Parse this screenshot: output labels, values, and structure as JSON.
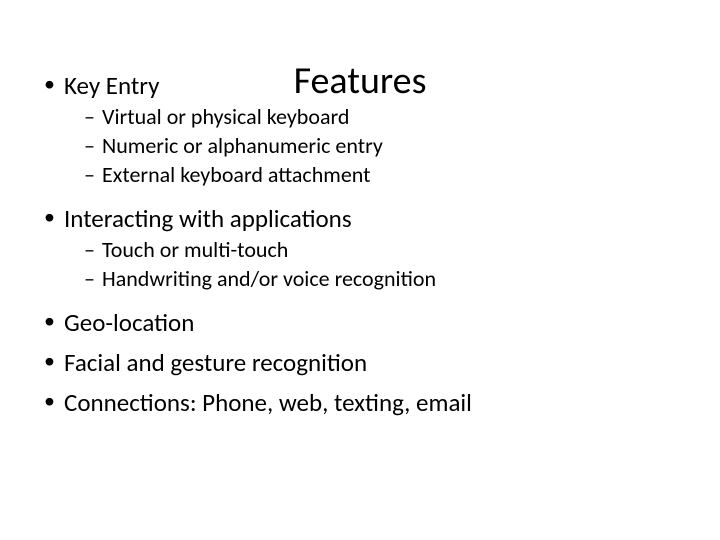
{
  "title": "Features",
  "items": {
    "keyEntry": {
      "label": "Key Entry",
      "subs": {
        "s0": "Virtual or physical keyboard",
        "s1": "Numeric or alphanumeric entry",
        "s2": "External keyboard attachment"
      }
    },
    "interacting": {
      "label": "Interacting with applications",
      "subs": {
        "s0": "Touch or multi-touch",
        "s1": "Handwriting and/or voice recognition"
      }
    },
    "geo": {
      "label": "Geo-location"
    },
    "facial": {
      "label": "Facial and gesture recognition"
    },
    "connections": {
      "label": "Connections: Phone, web, texting, email"
    }
  }
}
